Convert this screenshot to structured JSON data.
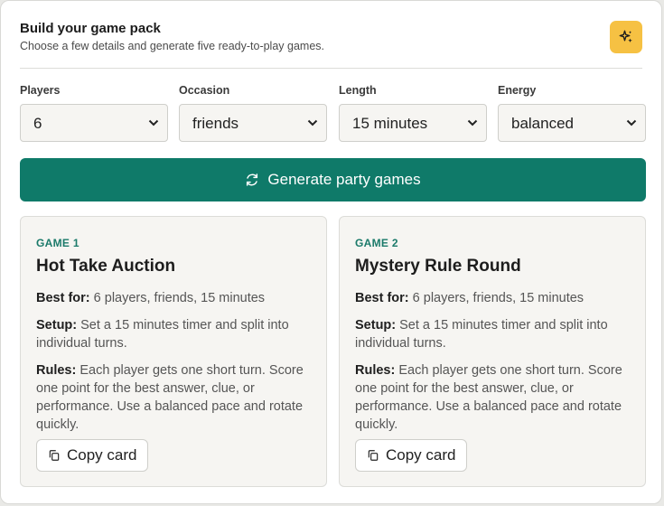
{
  "header": {
    "title": "Build your game pack",
    "subtitle": "Choose a few details and generate five ready-to-play games.",
    "action_icon": "sparkle-icon",
    "accent": "#f6c143"
  },
  "form": {
    "fields": [
      {
        "label": "Players",
        "value": "6"
      },
      {
        "label": "Occasion",
        "value": "friends"
      },
      {
        "label": "Length",
        "value": "15 minutes"
      },
      {
        "label": "Energy",
        "value": "balanced"
      }
    ]
  },
  "generate_button": {
    "label": "Generate party games",
    "icon": "refresh-icon",
    "color": "#0f7a69"
  },
  "cards": [
    {
      "number": "GAME 1",
      "title": "Hot Take Auction",
      "best_for_label": "Best for:",
      "best_for": "6 players, friends, 15 minutes",
      "setup_label": "Setup:",
      "setup": "Set a 15 minutes timer and split into individual turns.",
      "rules_label": "Rules:",
      "rules": "Each player gets one short turn. Score one point for the best answer, clue, or performance. Use a balanced pace and rotate quickly.",
      "copy_label": "Copy card"
    },
    {
      "number": "GAME 2",
      "title": "Mystery Rule Round",
      "best_for_label": "Best for:",
      "best_for": "6 players, friends, 15 minutes",
      "setup_label": "Setup:",
      "setup": "Set a 15 minutes timer and split into individual turns.",
      "rules_label": "Rules:",
      "rules": "Each player gets one short turn. Score one point for the best answer, clue, or performance. Use a balanced pace and rotate quickly.",
      "copy_label": "Copy card"
    }
  ]
}
